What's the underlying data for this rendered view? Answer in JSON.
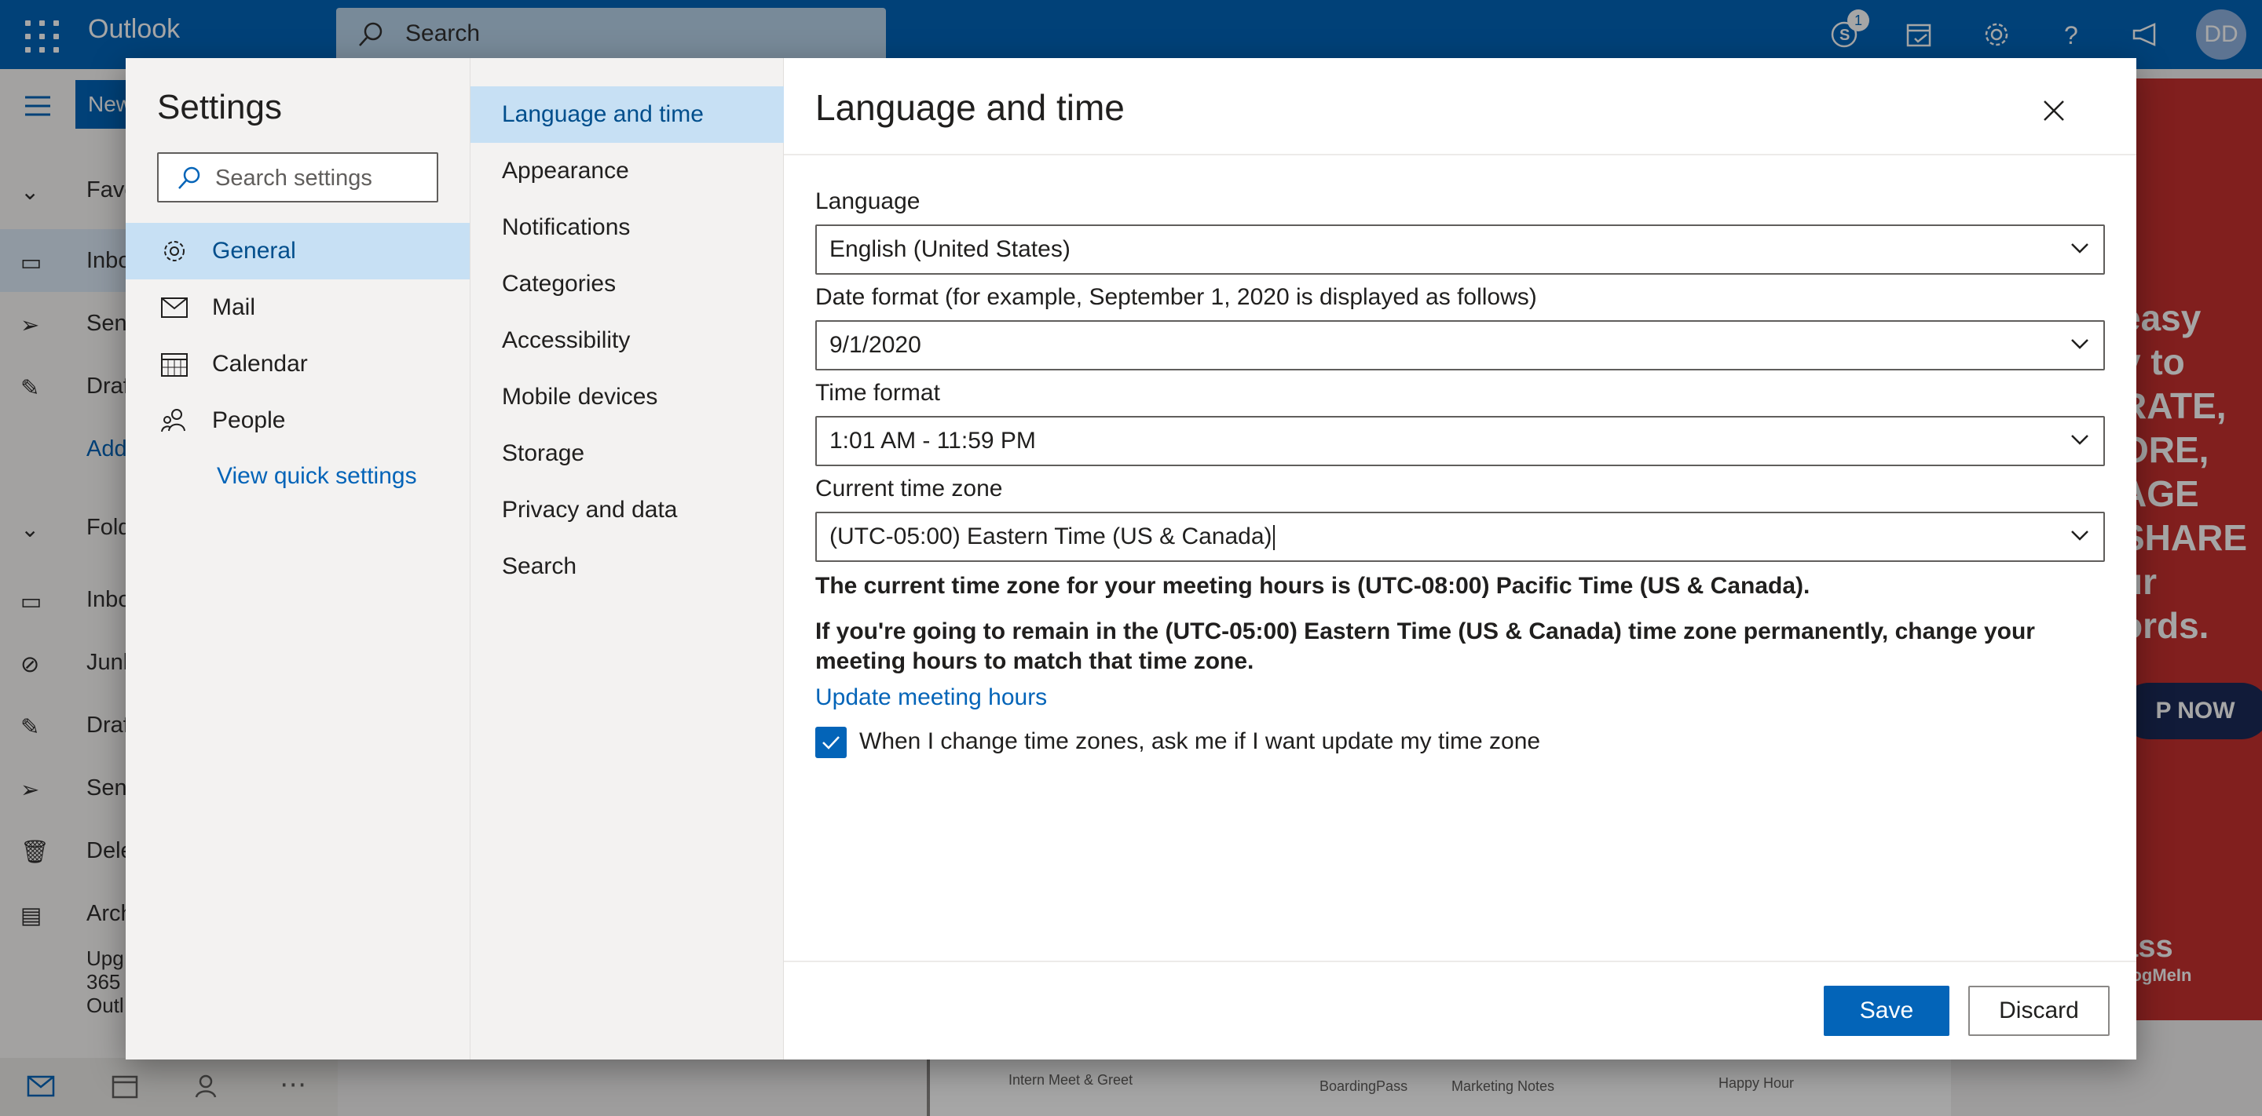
{
  "app": {
    "brand": "Outlook",
    "search_placeholder": "Search",
    "skype_badge": "1",
    "user_initials": "DD"
  },
  "background": {
    "new_label": "New",
    "folders": [
      "Favo",
      "Inbo",
      "Sent",
      "Draf",
      "Add",
      "Fold",
      "Inbo",
      "Junk",
      "Draf",
      "Sent",
      "Dele",
      "Arch"
    ],
    "upgrade_lines": [
      "Upg",
      "365",
      "Outl"
    ],
    "ad_lines": [
      "easy",
      "y to",
      "RATE,",
      "ORE,",
      "AGE",
      "SHARE",
      "ur",
      "ords."
    ],
    "ad_button": "P NOW",
    "ad_brand": "ass",
    "ad_sub": "LogMeIn",
    "thumbs": [
      "Intern Meet & Greet",
      "BoardingPass",
      "Marketing Notes",
      "Happy Hour"
    ]
  },
  "settings": {
    "title": "Settings",
    "search_placeholder": "Search settings",
    "categories": [
      {
        "label": "General",
        "icon": "gear-icon"
      },
      {
        "label": "Mail",
        "icon": "mail-icon"
      },
      {
        "label": "Calendar",
        "icon": "calendar-icon"
      },
      {
        "label": "People",
        "icon": "people-icon"
      }
    ],
    "quick_settings": "View quick settings",
    "subcategories": [
      "Language and time",
      "Appearance",
      "Notifications",
      "Categories",
      "Accessibility",
      "Mobile devices",
      "Storage",
      "Privacy and data",
      "Search"
    ]
  },
  "pane": {
    "title": "Language and time",
    "language_label": "Language",
    "language_value": "English (United States)",
    "date_label": "Date format (for example, September 1, 2020 is displayed as follows)",
    "date_value": "9/1/2020",
    "time_label": "Time format",
    "time_value": "1:01 AM - 11:59 PM",
    "tz_label": "Current time zone",
    "tz_value": "(UTC-05:00) Eastern Time (US & Canada)",
    "note1": "The current time zone for your meeting hours is (UTC-08:00) Pacific Time (US & Canada).",
    "note2": "If you're going to remain in the (UTC-05:00) Eastern Time (US & Canada) time zone permanently, change your meeting hours to match that time zone.",
    "update_link": "Update meeting hours",
    "checkbox_label": "When I change time zones, ask me if I want update my time zone",
    "checkbox_checked": true,
    "save": "Save",
    "discard": "Discard"
  },
  "colors": {
    "brand": "#0364b8",
    "selected": "#c7e0f4",
    "ad": "#c7312f"
  }
}
